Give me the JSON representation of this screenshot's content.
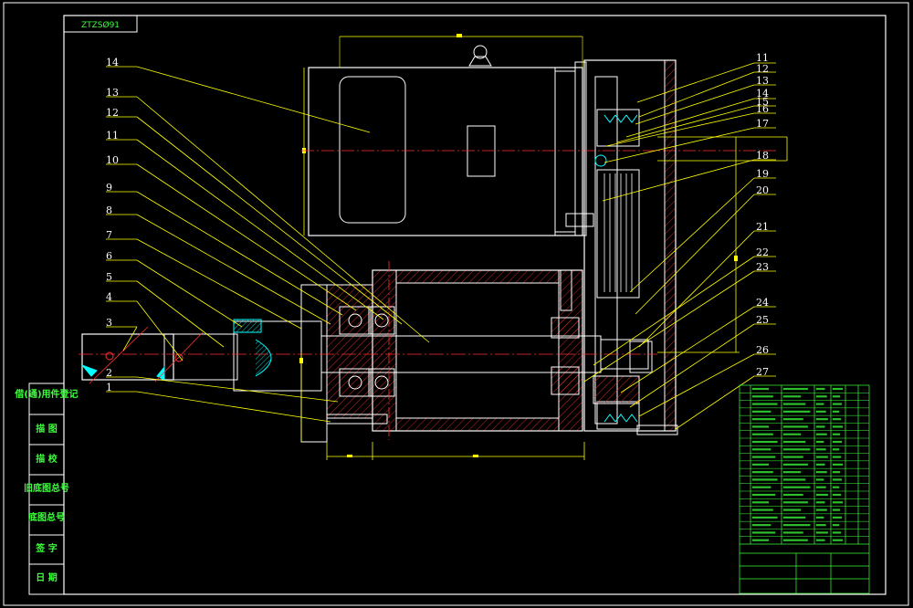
{
  "drawing": {
    "corner_tag": "ZTZSØ91",
    "colors": {
      "background": "#000000",
      "frame": "#ffffff",
      "geometry": "#ffffff",
      "leader": "#ffff00",
      "dimension": "#ffff00",
      "centerline": "#ff3030",
      "hatch": "#ff3030",
      "title_block": "#3cff3c",
      "highlight": "#00ffff"
    }
  },
  "side_panel": {
    "rows": [
      {
        "label": "借(通)用件登记"
      },
      {
        "label": "描 图"
      },
      {
        "label": "描 校"
      },
      {
        "label": "旧底图总号"
      },
      {
        "label": "底图总号"
      },
      {
        "label": "签 字"
      },
      {
        "label": "日 期"
      }
    ]
  },
  "left_callouts": [
    "14",
    "13",
    "12",
    "11",
    "10",
    "9",
    "8",
    "7",
    "6",
    "5",
    "4",
    "3",
    "2",
    "1"
  ],
  "right_callouts": [
    "11",
    "12",
    "13",
    "14",
    "15",
    "16",
    "17",
    "18",
    "19",
    "20",
    "21",
    "22",
    "23",
    "24",
    "25",
    "26",
    "27"
  ]
}
